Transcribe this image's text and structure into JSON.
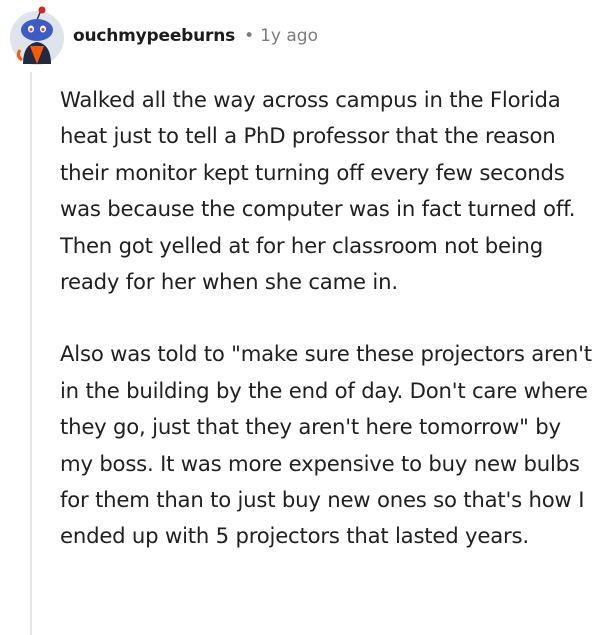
{
  "comment": {
    "author": "ouchmypeeburns",
    "separator": "•",
    "age": "1y ago",
    "paragraphs": [
      "Walked all the way across campus in the Florida heat just to tell a PhD professor that the reason their monitor kept turning off every few seconds was because the computer was in fact turned off. Then got yelled at for her classroom not being ready for her when she came in.",
      "Also was told to \"make sure these projectors aren't in the building by the end of day. Don't care where they go, just that they aren't here tomorrow\" by my boss. It was more expensive to buy new bulbs for them than to just buy new ones so that's how I ended up with 5 projectors that lasted years."
    ]
  },
  "colors": {
    "meta": "#7c7c7c",
    "thread_line": "#e6e6e6",
    "avatar_bg": "#dfe3ea",
    "avatar_face": "#3a5cc7",
    "avatar_antenna": "#d8232a"
  }
}
